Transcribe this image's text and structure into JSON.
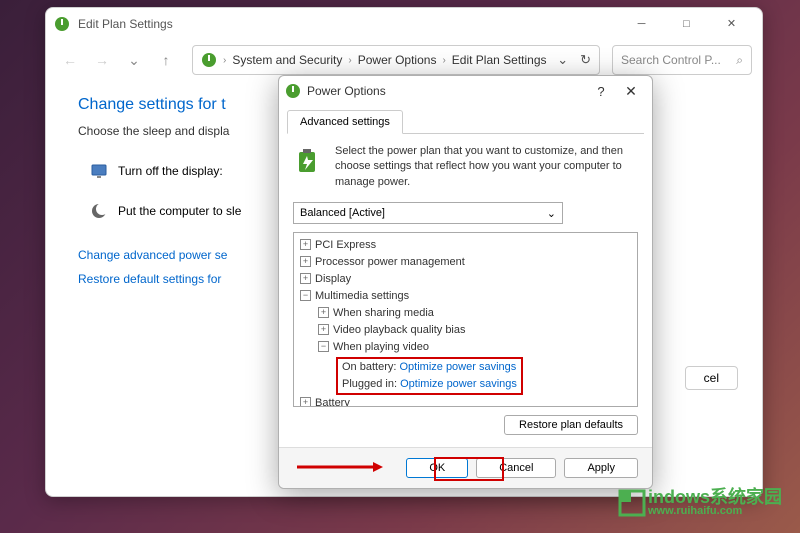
{
  "mainWindow": {
    "title": "Edit Plan Settings",
    "breadcrumb": {
      "item1": "System and Security",
      "item2": "Power Options",
      "item3": "Edit Plan Settings"
    },
    "searchPlaceholder": "Search Control P...",
    "heading": "Change settings for t",
    "subtext": "Choose the sleep and displa",
    "setting1": "Turn off the display:",
    "setting2": "Put the computer to sle",
    "link1": "Change advanced power se",
    "link2": "Restore default settings for",
    "cancelBtn": "cel"
  },
  "dialog": {
    "title": "Power Options",
    "tab": "Advanced settings",
    "introText": "Select the power plan that you want to customize, and then choose settings that reflect how you want your computer to manage power.",
    "planSelect": "Balanced [Active]",
    "tree": {
      "pci": "PCI Express",
      "ppm": "Processor power management",
      "display": "Display",
      "multimedia": "Multimedia settings",
      "sharing": "When sharing media",
      "playback": "Video playback quality bias",
      "playing": "When playing video",
      "onBattery": "On battery:",
      "onBatteryVal": "Optimize power savings",
      "pluggedIn": "Plugged in:",
      "pluggedInVal": "Optimize power savings",
      "battery": "Battery"
    },
    "restoreBtn": "Restore plan defaults",
    "ok": "OK",
    "cancel": "Cancel",
    "apply": "Apply"
  },
  "watermark": {
    "text": "indows系统家园",
    "sub": "www.ruihaifu.com"
  }
}
